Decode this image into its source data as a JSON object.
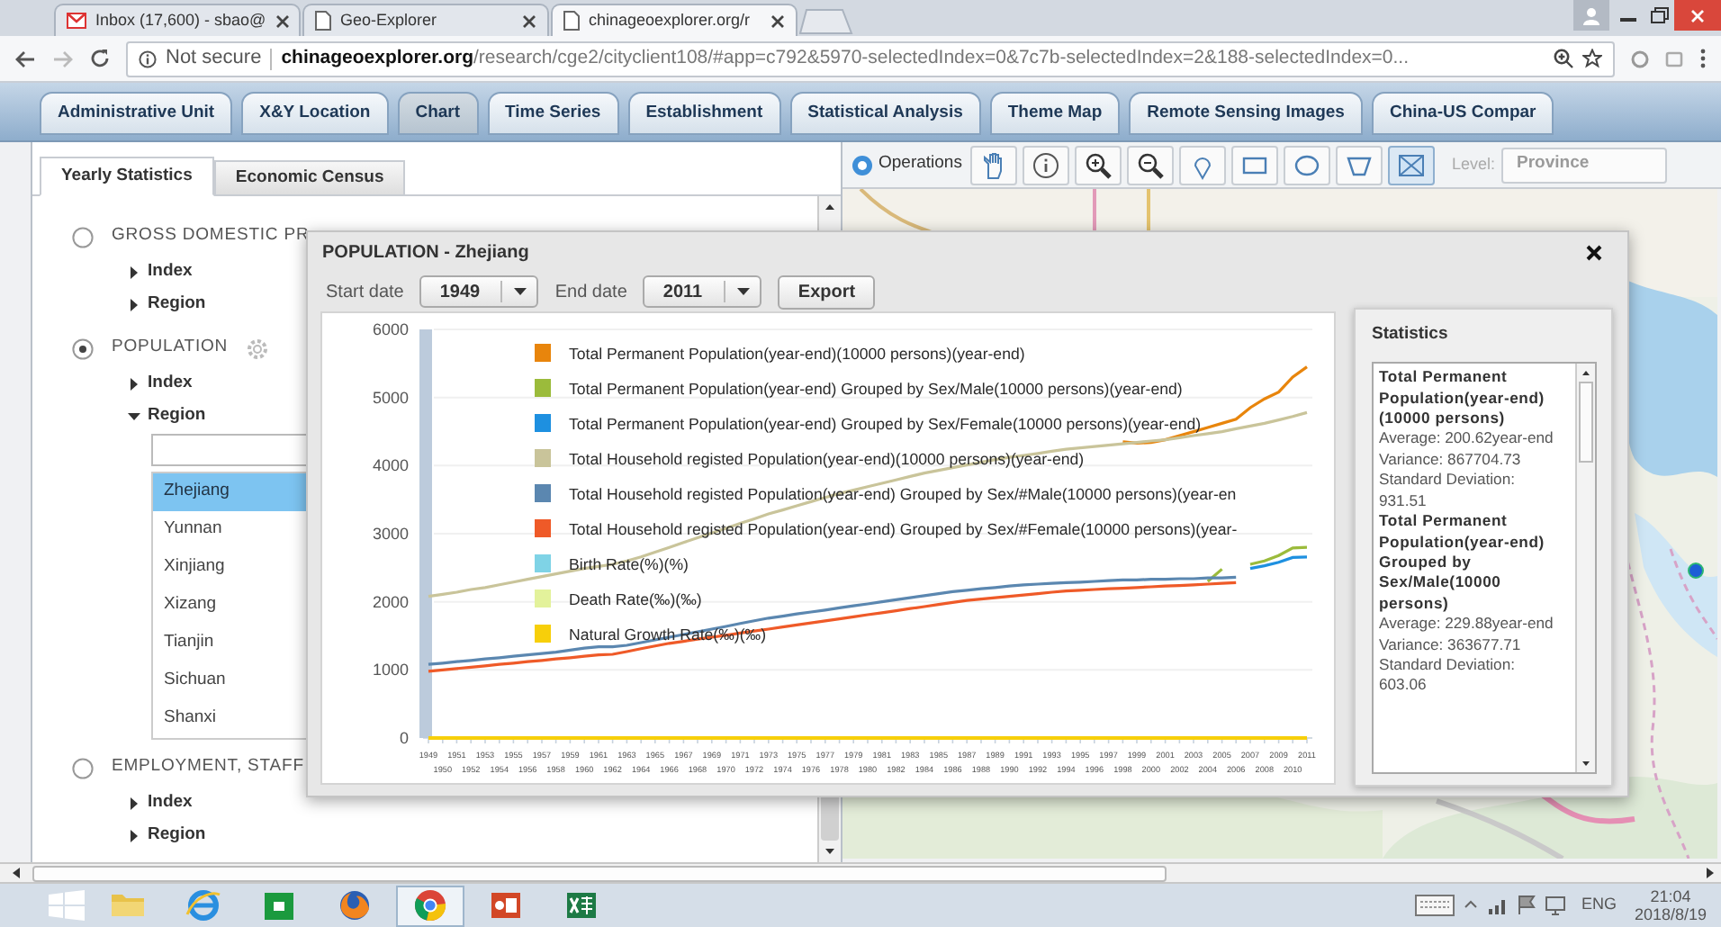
{
  "browser": {
    "tabs": [
      {
        "kind": "mail",
        "title": "Inbox (17,600) - sbao@",
        "selected": false
      },
      {
        "kind": "page",
        "title": "Geo-Explorer",
        "selected": false
      },
      {
        "kind": "page",
        "title": "chinageoexplorer.org/r",
        "selected": true
      }
    ],
    "security": "Not secure",
    "url": "**chinageoexplorer.org**/research/cge2/cityclient108/#app=c792&5970-selectedIndex=0&7c7b-selectedIndex=2&188-selectedIndex=0..."
  },
  "nav_tabs": [
    {
      "label": "Administrative Unit",
      "selected": false
    },
    {
      "label": "X&Y Location",
      "selected": false
    },
    {
      "label": "Chart",
      "selected": true
    },
    {
      "label": "Time Series",
      "selected": false
    },
    {
      "label": "Establishment",
      "selected": false
    },
    {
      "label": "Statistical Analysis",
      "selected": false
    },
    {
      "label": "Theme Map",
      "selected": false
    },
    {
      "label": "Remote Sensing Images",
      "selected": false
    },
    {
      "label": "China-US Compar",
      "selected": false
    }
  ],
  "left_panel": {
    "tabs": [
      {
        "label": "Yearly Statistics",
        "selected": true
      },
      {
        "label": "Economic Census",
        "selected": false
      }
    ],
    "categories": [
      {
        "label": "GROSS DOMESTIC PR",
        "selected": false,
        "children": [
          {
            "label": "Index",
            "expanded": false
          },
          {
            "label": "Region",
            "expanded": false
          }
        ]
      },
      {
        "label": "POPULATION",
        "selected": true,
        "children": [
          {
            "label": "Index",
            "expanded": false
          },
          {
            "label": "Region",
            "expanded": true,
            "regions": [
              {
                "label": "Zhejiang",
                "selected": true
              },
              {
                "label": "Yunnan",
                "selected": false
              },
              {
                "label": "Xinjiang",
                "selected": false
              },
              {
                "label": "Xizang",
                "selected": false
              },
              {
                "label": "Tianjin",
                "selected": false
              },
              {
                "label": "Sichuan",
                "selected": false
              },
              {
                "label": "Shanxi",
                "selected": false
              }
            ]
          }
        ]
      },
      {
        "label": "EMPLOYMENT, STAFF",
        "selected": false,
        "children": [
          {
            "label": "Index",
            "expanded": false
          },
          {
            "label": "Region",
            "expanded": false
          }
        ]
      }
    ]
  },
  "map": {
    "operations": "Operations",
    "tools": [
      {
        "kind": "pan",
        "selected": false
      },
      {
        "kind": "info",
        "selected": false
      },
      {
        "kind": "zoom_in",
        "selected": false
      },
      {
        "kind": "zoom_out",
        "selected": false
      },
      {
        "kind": "pin",
        "selected": false
      },
      {
        "kind": "rectangle",
        "selected": false
      },
      {
        "kind": "circle",
        "selected": false
      },
      {
        "kind": "polygon",
        "selected": false
      },
      {
        "kind": "envelope",
        "selected": true
      }
    ],
    "level_label": "Level:",
    "level_value": "Province"
  },
  "dialog": {
    "title": "POPULATION - Zhejiang",
    "start_label": "Start date",
    "start": "1949",
    "end_label": "End date",
    "end": "2011",
    "export": "Export",
    "chart_data": {
      "type": "line",
      "x": [
        "1949",
        "1950",
        "1951",
        "1952",
        "1953",
        "1954",
        "1955",
        "1956",
        "1957",
        "1958",
        "1959",
        "1960",
        "1961",
        "1962",
        "1963",
        "1964",
        "1965",
        "1966",
        "1967",
        "1968",
        "1969",
        "1970",
        "1971",
        "1972",
        "1973",
        "1974",
        "1975",
        "1976",
        "1977",
        "1978",
        "1979",
        "1980",
        "1981",
        "1982",
        "1983",
        "1984",
        "1985",
        "1986",
        "1987",
        "1988",
        "1989",
        "1990",
        "1991",
        "1992",
        "1993",
        "1994",
        "1995",
        "1996",
        "1997",
        "1998",
        "1999",
        "2000",
        "2001",
        "2002",
        "2003",
        "2004",
        "2005",
        "2006",
        "2007",
        "2008",
        "2009",
        "2010",
        "2011"
      ],
      "ylim": [
        0,
        6000
      ],
      "yticks": [
        0,
        1000,
        2000,
        3000,
        4000,
        5000,
        6000
      ],
      "series": [
        {
          "name": "Total Permanent Population(year-end)(10000 persons)(year-end)",
          "color": "#e8850c",
          "values": [
            null,
            null,
            null,
            null,
            null,
            null,
            null,
            null,
            null,
            null,
            null,
            null,
            null,
            null,
            null,
            null,
            null,
            null,
            null,
            null,
            null,
            null,
            null,
            null,
            null,
            null,
            null,
            null,
            null,
            null,
            null,
            null,
            null,
            null,
            null,
            null,
            null,
            null,
            null,
            null,
            null,
            null,
            null,
            null,
            null,
            null,
            null,
            null,
            null,
            4350,
            4330,
            4340,
            4380,
            4440,
            4500,
            4560,
            4620,
            4680,
            4850,
            4980,
            5080,
            5300,
            5450
          ]
        },
        {
          "name": "Total Permanent Population(year-end) Grouped by Sex/Male(10000 persons)(year-end)",
          "color": "#9bbb3b",
          "values": [
            null,
            null,
            null,
            null,
            null,
            null,
            null,
            null,
            null,
            null,
            null,
            null,
            null,
            null,
            null,
            null,
            null,
            null,
            null,
            null,
            null,
            null,
            null,
            null,
            null,
            null,
            null,
            null,
            null,
            null,
            null,
            null,
            null,
            null,
            null,
            null,
            null,
            null,
            null,
            null,
            null,
            null,
            null,
            null,
            null,
            null,
            null,
            null,
            null,
            null,
            null,
            null,
            null,
            null,
            null,
            2300,
            2480,
            null,
            2550,
            2600,
            2680,
            2790,
            2800
          ]
        },
        {
          "name": "Total Permanent Population(year-end) Grouped by Sex/Female(10000 persons)(year-end)",
          "color": "#1e90e0",
          "values": [
            null,
            null,
            null,
            null,
            null,
            null,
            null,
            null,
            null,
            null,
            null,
            null,
            null,
            null,
            null,
            null,
            null,
            null,
            null,
            null,
            null,
            null,
            null,
            null,
            null,
            null,
            null,
            null,
            null,
            null,
            null,
            null,
            null,
            null,
            null,
            null,
            null,
            null,
            null,
            null,
            null,
            null,
            null,
            null,
            null,
            null,
            null,
            null,
            null,
            null,
            null,
            null,
            null,
            null,
            null,
            null,
            null,
            null,
            2490,
            2530,
            2580,
            2650,
            2660
          ]
        },
        {
          "name": "Total Household registed Population(year-end)(10000 persons)(year-end)",
          "color": "#c9c49a",
          "values": [
            2080,
            2110,
            2140,
            2180,
            2210,
            2250,
            2290,
            2330,
            2370,
            2410,
            2450,
            2490,
            2520,
            2550,
            2600,
            2660,
            2730,
            2800,
            2870,
            2940,
            3010,
            3080,
            3150,
            3220,
            3290,
            3350,
            3410,
            3470,
            3530,
            3590,
            3640,
            3690,
            3740,
            3790,
            3840,
            3890,
            3930,
            3970,
            4010,
            4050,
            4090,
            4120,
            4150,
            4180,
            4210,
            4240,
            4260,
            4280,
            4300,
            4320,
            4340,
            4360,
            4380,
            4410,
            4440,
            4470,
            4500,
            4540,
            4580,
            4620,
            4670,
            4720,
            4780
          ]
        },
        {
          "name": "Total Household registed Population(year-end) Grouped by Sex/#Male(10000 persons)(year-en",
          "color": "#5b87b0",
          "values": [
            1080,
            1100,
            1120,
            1140,
            1160,
            1180,
            1200,
            1220,
            1240,
            1260,
            1290,
            1320,
            1340,
            1340,
            1360,
            1400,
            1440,
            1480,
            1520,
            1560,
            1600,
            1640,
            1680,
            1720,
            1760,
            1790,
            1820,
            1850,
            1880,
            1910,
            1940,
            1970,
            2000,
            2030,
            2060,
            2090,
            2120,
            2150,
            2170,
            2190,
            2210,
            2230,
            2250,
            2260,
            2270,
            2280,
            2290,
            2300,
            2310,
            2320,
            2320,
            2330,
            2330,
            2340,
            2340,
            2350,
            2350,
            2360,
            null,
            null,
            null,
            null,
            null
          ]
        },
        {
          "name": "Total Household registed Population(year-end) Grouped by Sex/#Female(10000 persons)(year-",
          "color": "#ef5a28",
          "values": [
            980,
            1000,
            1020,
            1040,
            1060,
            1080,
            1100,
            1120,
            1140,
            1160,
            1180,
            1200,
            1220,
            1230,
            1270,
            1310,
            1350,
            1390,
            1420,
            1450,
            1480,
            1510,
            1540,
            1570,
            1600,
            1630,
            1660,
            1690,
            1720,
            1750,
            1780,
            1810,
            1840,
            1870,
            1900,
            1930,
            1960,
            1990,
            2020,
            2040,
            2060,
            2080,
            2100,
            2120,
            2140,
            2160,
            2170,
            2180,
            2190,
            2200,
            2210,
            2220,
            2230,
            2240,
            2250,
            2260,
            2270,
            2280,
            null,
            null,
            null,
            null,
            null
          ]
        },
        {
          "name": "Birth Rate(%)(%)",
          "color": "#7fd3e6",
          "values": [
            null,
            null,
            null,
            null,
            null,
            null,
            null,
            null,
            null,
            null,
            null,
            null,
            null,
            null,
            null,
            null,
            null,
            null,
            null,
            null,
            null,
            null,
            null,
            null,
            null,
            null,
            null,
            null,
            null,
            null,
            null,
            null,
            null,
            null,
            null,
            null,
            null,
            null,
            null,
            null,
            null,
            null,
            null,
            null,
            null,
            null,
            null,
            null,
            null,
            null,
            null,
            null,
            null,
            null,
            null,
            null,
            null,
            null,
            null,
            null,
            null,
            null,
            null
          ]
        },
        {
          "name": "Death Rate(‰)(‰)",
          "color": "#e3f29b",
          "values": [
            null,
            null,
            null,
            null,
            null,
            null,
            null,
            null,
            null,
            null,
            null,
            null,
            null,
            null,
            null,
            null,
            null,
            null,
            null,
            null,
            null,
            null,
            null,
            null,
            null,
            null,
            null,
            null,
            null,
            null,
            null,
            null,
            null,
            null,
            null,
            null,
            null,
            null,
            null,
            null,
            null,
            null,
            null,
            null,
            null,
            null,
            null,
            null,
            null,
            null,
            null,
            null,
            null,
            null,
            null,
            null,
            null,
            null,
            null,
            null,
            null,
            null,
            null
          ]
        },
        {
          "name": "Natural Growth Rate(‰)(‰)",
          "color": "#f7cf0a",
          "values": [
            0,
            0,
            0,
            0,
            0,
            0,
            0,
            0,
            0,
            0,
            0,
            0,
            0,
            0,
            0,
            0,
            0,
            0,
            0,
            0,
            0,
            0,
            0,
            0,
            0,
            0,
            0,
            0,
            0,
            0,
            0,
            0,
            0,
            0,
            0,
            0,
            0,
            0,
            0,
            0,
            0,
            0,
            0,
            0,
            0,
            0,
            0,
            0,
            0,
            0,
            0,
            0,
            0,
            0,
            0,
            0,
            0,
            0,
            0,
            0,
            0,
            0,
            0
          ]
        }
      ],
      "grid": true,
      "legend": true
    },
    "statistics": {
      "title": "Statistics",
      "entries": [
        {
          "title": "Total Permanent Population(year-end)(10000 persons)",
          "lines": [
            "Average: 200.62year-end",
            "Variance: 867704.73",
            "Standard Deviation: 931.51"
          ]
        },
        {
          "title": "Total Permanent Population(year-end) Grouped by Sex/Male(10000 persons)",
          "lines": [
            "Average: 229.88year-end",
            "Variance: 363677.71",
            "Standard Deviation: 603.06"
          ]
        }
      ]
    }
  },
  "taskbar": {
    "apps": [
      {
        "kind": "explorer",
        "selected": false
      },
      {
        "kind": "ie",
        "selected": false
      },
      {
        "kind": "store",
        "selected": false
      },
      {
        "kind": "firefox",
        "selected": false
      },
      {
        "kind": "chrome",
        "selected": true
      },
      {
        "kind": "powerpoint",
        "selected": false
      },
      {
        "kind": "excel",
        "selected": false
      }
    ],
    "language": "ENG",
    "time": "21:04",
    "date": "2018/8/19"
  }
}
